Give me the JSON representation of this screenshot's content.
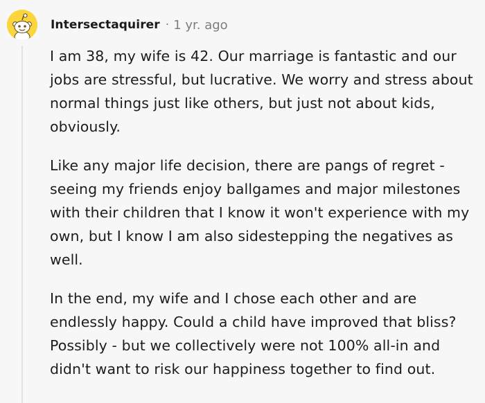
{
  "comment": {
    "author": "Intersectaquirer",
    "separator": "·",
    "age": "1 yr. ago",
    "avatar_icon": "snoo-avatar-icon",
    "avatar_color": "#fcd43b",
    "paragraphs": [
      "I am 38, my wife is 42. Our marriage is fantastic and our jobs are stressful, but lucrative. We worry and stress about normal things just like others, but just not about kids, obviously.",
      "Like any major life decision, there are pangs of regret - seeing my friends enjoy ballgames and major milestones with their children that I know it won't experience with my own, but I know I am also sidestepping the negatives as well.",
      "In the end, my wife and I chose each other and are endlessly happy. Could a child have improved that bliss? Possibly - but we collectively were not 100% all-in and didn't want to risk our happiness together to find out."
    ]
  }
}
